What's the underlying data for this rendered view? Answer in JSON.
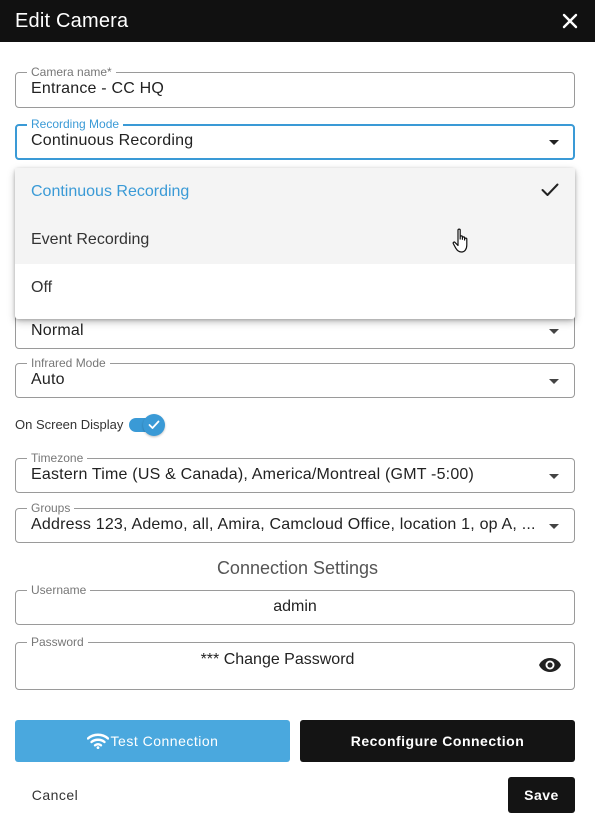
{
  "dialog": {
    "title": "Edit Camera"
  },
  "fields": {
    "camera_name": {
      "label": "Camera name*",
      "value": "Entrance - CC HQ"
    },
    "recording_mode": {
      "label": "Recording Mode",
      "value": "Continuous Recording"
    },
    "hidden_select": {
      "value": "Normal"
    },
    "infrared_mode": {
      "label": "Infrared Mode",
      "value": "Auto"
    },
    "timezone": {
      "label": "Timezone",
      "value": "Eastern Time (US & Canada), America/Montreal (GMT -5:00)"
    },
    "groups": {
      "label": "Groups",
      "value": "Address 123, Ademo, all, Amira, Camcloud Office, location 1, op A, ..."
    },
    "username": {
      "label": "Username",
      "value": "admin"
    },
    "password": {
      "label": "Password",
      "value": "*** Change Password"
    }
  },
  "dropdown": {
    "options": [
      {
        "label": "Continuous Recording",
        "selected": true
      },
      {
        "label": "Event Recording",
        "selected": false
      },
      {
        "label": "Off",
        "selected": false
      }
    ]
  },
  "osd": {
    "label": "On Screen Display",
    "enabled": true
  },
  "connection": {
    "section_title": "Connection Settings"
  },
  "buttons": {
    "test": "Test Connection",
    "reconfigure": "Reconfigure Connection",
    "cancel": "Cancel",
    "save": "Save"
  },
  "icons": {
    "close": "close-icon",
    "check": "check-icon",
    "cursor": "hand-pointer-icon",
    "eye": "eye-icon",
    "wifi": "wifi-icon",
    "caret": "chevron-down-icon"
  },
  "colors": {
    "accent": "#3a9ad6",
    "dark": "#141414",
    "test_button": "#4aa8de"
  }
}
